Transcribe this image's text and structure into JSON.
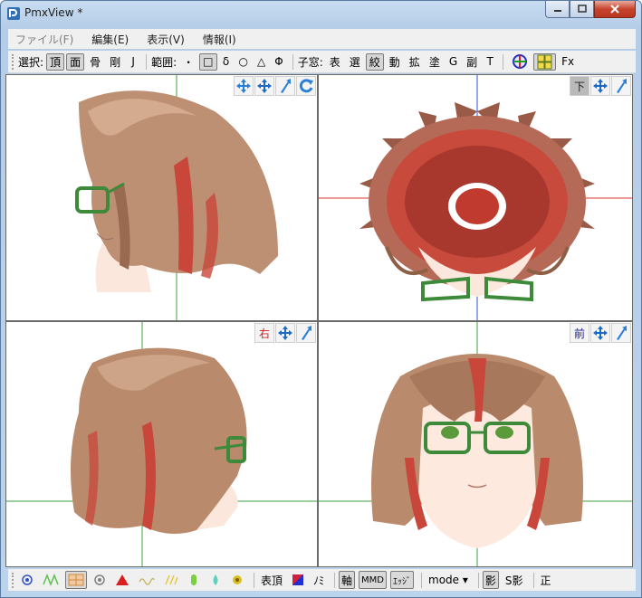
{
  "window": {
    "title": "PmxView *"
  },
  "menu": [
    {
      "label": "ファイル(F)",
      "enabled": false
    },
    {
      "label": "編集(E)",
      "enabled": true
    },
    {
      "label": "表示(V)",
      "enabled": true
    },
    {
      "label": "情報(I)",
      "enabled": true
    }
  ],
  "toolbar": {
    "select_label": "選択:",
    "select_vertex": "頂",
    "select_face": "面",
    "select_bone": "骨",
    "select_rigid": "剛",
    "select_joint": "J",
    "range_label": "範囲:",
    "range_dot": "・",
    "range_rect": "□",
    "range_delta": "δ",
    "range_circle": "○",
    "range_triangle": "△",
    "range_phi": "Φ",
    "sub_label": "子窓:",
    "sub_table": "表",
    "sub_select": "選",
    "sub_narrow": "絞",
    "sub_move": "動",
    "sub_scale": "拡",
    "sub_paint": "塗",
    "sub_g": "G",
    "sub_sub": "副",
    "sub_t": "T",
    "fx_label": "Fx"
  },
  "viewports": {
    "bottom_label": "下",
    "right_label": "右",
    "front_label": "前"
  },
  "statusbar": {
    "surface_label": "表頂",
    "mi_label": "ﾉﾐ",
    "axis_label": "軸",
    "mmd_label": "MMD",
    "edge_label": "ｴｯｼﾞ",
    "mode_label": "mode ▾",
    "shadow_label": "影",
    "sshadow_label": "S影",
    "correct_label": "正"
  },
  "colors": {
    "hair": "#b98a6c",
    "hair_dark": "#8d5f45",
    "hair_red": "#c9463a",
    "skin": "#fde9de",
    "glasses": "#3d8a3a",
    "axis_green": "#3ea13e",
    "axis_red": "#e03030",
    "axis_blue": "#3050e0"
  }
}
